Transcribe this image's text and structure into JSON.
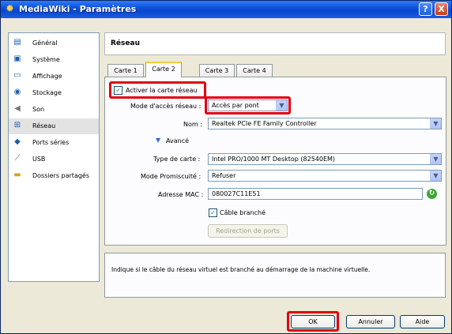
{
  "window": {
    "title": "MediaWiki - Paramètres",
    "help_label": "?",
    "close_label": "X"
  },
  "sidebar": {
    "items": [
      {
        "label": "Général",
        "icon": "general-icon"
      },
      {
        "label": "Système",
        "icon": "system-icon"
      },
      {
        "label": "Affichage",
        "icon": "display-icon"
      },
      {
        "label": "Stockage",
        "icon": "storage-icon"
      },
      {
        "label": "Son",
        "icon": "sound-icon"
      },
      {
        "label": "Réseau",
        "icon": "network-icon",
        "selected": true
      },
      {
        "label": "Ports séries",
        "icon": "serial-ports-icon"
      },
      {
        "label": "USB",
        "icon": "usb-icon"
      },
      {
        "label": "Dossiers partagés",
        "icon": "shared-folders-icon"
      }
    ]
  },
  "section_title": "Réseau",
  "tabs": [
    "Carte 1",
    "Carte 2",
    "Carte 3",
    "Carte 4"
  ],
  "active_tab": "Carte 2",
  "form": {
    "enable_label": "Activer la carte réseau",
    "enable_checked": true,
    "access_mode_label": "Mode d'accès réseau :",
    "access_mode_value": "Accès par pont",
    "name_label": "Nom :",
    "name_value": "Realtek PCIe FE Family Controller",
    "advanced_label": "Avancé",
    "card_type_label": "Type de carte :",
    "card_type_value": "Intel PRO/1000 MT Desktop (82540EM)",
    "promisc_label": "Mode Promiscuité :",
    "promisc_value": "Refuser",
    "mac_label": "Adresse MAC :",
    "mac_value": "080027C11E51",
    "cable_label": "Câble branché",
    "cable_checked": true,
    "port_forward_label": "Redirection de ports"
  },
  "info_text": "Indique si le câble du réseau virtuel est branché au démarrage de la machine virtuelle.",
  "buttons": {
    "ok": "OK",
    "cancel": "Annuler",
    "help": "Aide"
  },
  "colors": {
    "highlight": "#e10010",
    "title_bar": "#0c4ed8"
  }
}
